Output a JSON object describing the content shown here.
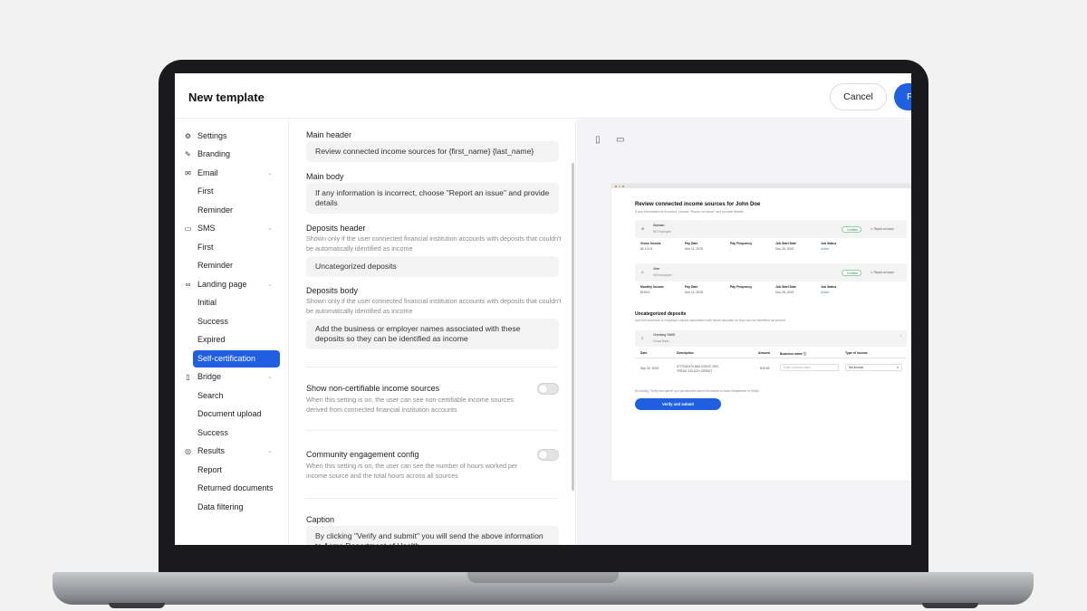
{
  "header": {
    "title": "New template",
    "cancel_label": "Cancel",
    "primary_label": "P"
  },
  "sidebar": {
    "sections": [
      {
        "label": "Settings",
        "icon": "gear-icon"
      },
      {
        "label": "Branding",
        "icon": "pen-icon"
      },
      {
        "label": "Email",
        "icon": "mail-icon",
        "items": [
          "First",
          "Reminder"
        ]
      },
      {
        "label": "SMS",
        "icon": "chat-icon",
        "items": [
          "First",
          "Reminder"
        ]
      },
      {
        "label": "Landing page",
        "icon": "link-icon",
        "items": [
          "Initial",
          "Success",
          "Expired",
          "Self-certification"
        ],
        "active_item": "Self-certification"
      },
      {
        "label": "Bridge",
        "icon": "phone-icon",
        "items": [
          "Search",
          "Document upload",
          "Success"
        ]
      },
      {
        "label": "Results",
        "icon": "check-circle-icon",
        "items": [
          "Report",
          "Returned documents",
          "Data filtering"
        ]
      }
    ]
  },
  "form": {
    "main_header": {
      "label": "Main header",
      "value": "Review connected income sources for {first_name} {last_name}"
    },
    "main_body": {
      "label": "Main body",
      "value": "If any information is incorrect, choose \"Report an issue\" and provide details"
    },
    "deposits_header": {
      "label": "Deposits header",
      "help": "Shown only if the user connected financial institution accounts with deposits that couldn't be automatically identified as income",
      "value": "Uncategorized deposits"
    },
    "deposits_body": {
      "label": "Deposits body",
      "help": "Shown only if the user connected financial institution accounts with deposits that couldn't be automatically identified as income",
      "value": "Add the business or employer names associated with these deposits so they can be identified as income"
    },
    "noncertifiable": {
      "label": "Show non-certifiable income sources",
      "help": "When this setting is on, the user can see non-certifiable income sources derived from connected financial institution accounts",
      "enabled": false
    },
    "community": {
      "label": "Community engagement config",
      "help": "When this setting is on, the user can see the number of hours worked per income source and the total hours across all sources",
      "enabled": false
    },
    "caption": {
      "label": "Caption",
      "value": "By clicking \"Verify and submit\" you will send the above information to Acme Department of Health"
    }
  },
  "preview": {
    "title": "Review connected income sources for John Doe",
    "subtitle": "If any information is incorrect, choose \"Report an issue\" and provide details",
    "sources": [
      {
        "initial": "W",
        "name": "Walmart",
        "type": "W2 Employee",
        "badge": "Certified",
        "report": "Report an issue",
        "fields": [
          {
            "k": "Gross Income",
            "v": "$2,170.6"
          },
          {
            "k": "Pay Date",
            "v": "Nov 11, 2025"
          },
          {
            "k": "Pay Frequency",
            "v": "-"
          },
          {
            "k": "Job Start Date",
            "v": "Nov 28, 2023"
          },
          {
            "k": "Job Status",
            "v": "Active"
          }
        ]
      },
      {
        "initial": "U",
        "name": "Uber",
        "type": "Self-employed",
        "badge": "Certified",
        "report": "Report an issue",
        "fields": [
          {
            "k": "Monthly Income",
            "v": "$159.6"
          },
          {
            "k": "Pay Date",
            "v": "Nov 11, 2025"
          },
          {
            "k": "Pay Frequency",
            "v": "-"
          },
          {
            "k": "Job Start Date",
            "v": "Nov 28, 2023"
          },
          {
            "k": "Job Status",
            "v": "Active"
          }
        ]
      }
    ],
    "deposits_title": "Uncategorized deposits",
    "deposits_subtitle": "Add the business or employer names associated with these deposits so they can be identified as income",
    "account": {
      "initial": "C",
      "name": "Checking *0665",
      "bank": "Chase Bank"
    },
    "table_headers": [
      "Date",
      "Description",
      "Amount",
      "Business name ⓘ",
      "Type of income"
    ],
    "row": {
      "date": "Sep 30, 2025",
      "description_1": "3777040474 86A XXSOC SEC",
      "description_2": "TREAS 310 ACH CREDIT",
      "amount": "$49.69",
      "business_placeholder": "Enter business name",
      "income_type": "Not income"
    },
    "caption": "By clicking \"Verify and submit\" you will send the above information to Acme Department of Health",
    "verify_label": "Verify and submit"
  },
  "colors": {
    "accent": "#1f5fe0",
    "certified": "#2aa052"
  }
}
